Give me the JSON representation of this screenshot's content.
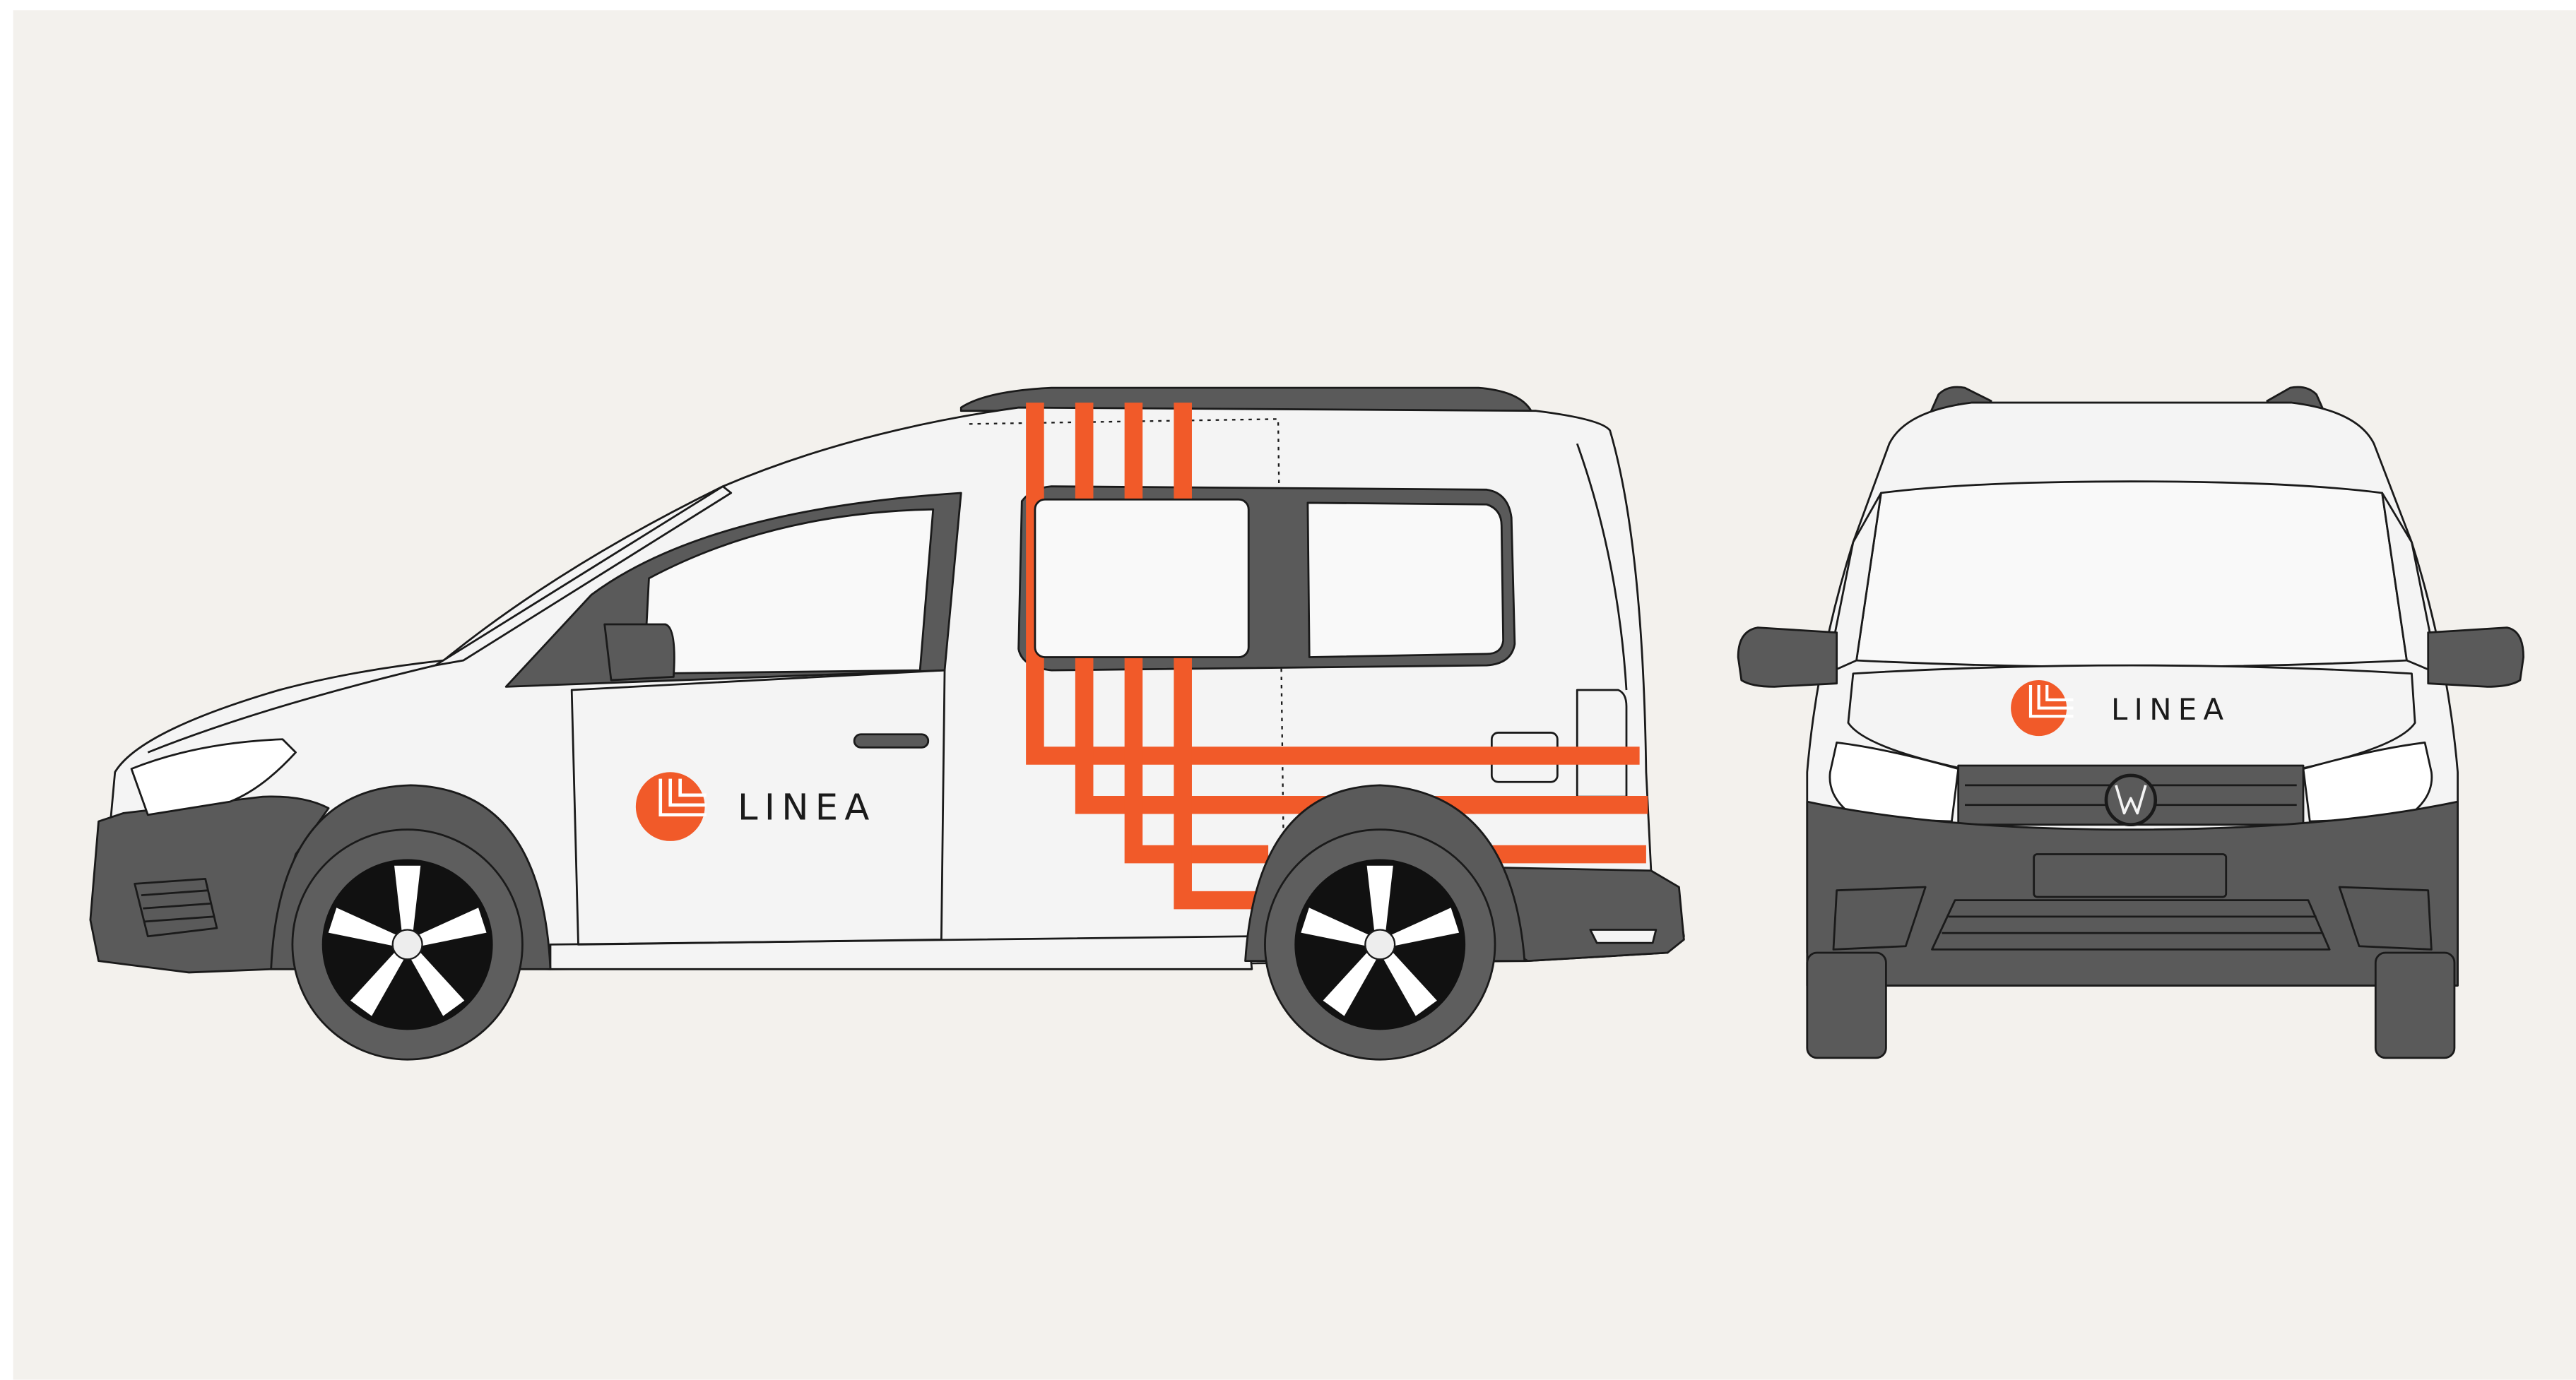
{
  "brand": {
    "name": "LINEA",
    "accent_color": "#F15A29",
    "text_color": "#1A1A1A"
  },
  "palette": {
    "backdrop": "#F3F1ED",
    "body": "#F4F4F4",
    "glass": "#F9F9F9",
    "trim": "#5A5A5A",
    "outline": "#1A1A1A",
    "tire": "#5E5E5E",
    "rim_dark": "#111111"
  },
  "views": [
    {
      "id": "side-view",
      "icon": "van-side-icon"
    },
    {
      "id": "front-view",
      "icon": "van-front-icon"
    }
  ]
}
